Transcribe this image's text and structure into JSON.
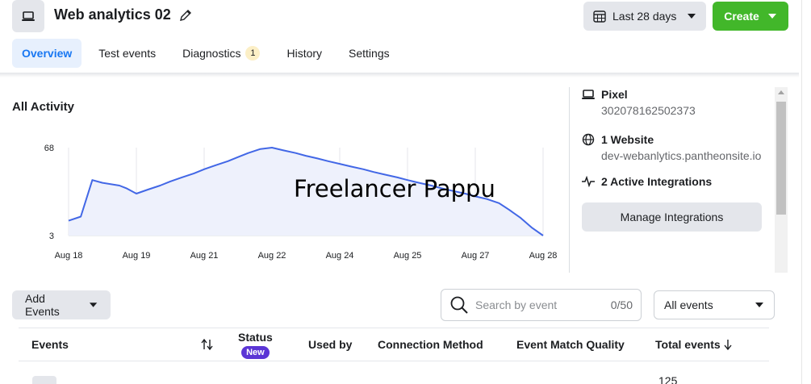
{
  "header": {
    "title": "Web analytics 02",
    "date_range": "Last 28 days",
    "create_label": "Create"
  },
  "tabs": [
    {
      "label": "Overview",
      "active": true
    },
    {
      "label": "Test events"
    },
    {
      "label": "Diagnostics",
      "badge": "1"
    },
    {
      "label": "History"
    },
    {
      "label": "Settings"
    }
  ],
  "activity": {
    "title": "All Activity",
    "watermark": "Freelancer Pappu"
  },
  "chart_data": {
    "type": "area",
    "categories": [
      "Aug 18",
      "Aug 19",
      "Aug 21",
      "Aug 22",
      "Aug 24",
      "Aug 25",
      "Aug 27",
      "Aug 28"
    ],
    "y_ticks": [
      "68",
      "3"
    ],
    "ylim": [
      3,
      68
    ],
    "x_positions": [
      0,
      0.18,
      0.35,
      0.5,
      0.75,
      0.85,
      1.0,
      1.17,
      1.35,
      1.5,
      1.67,
      1.85,
      2.0,
      2.17,
      2.35,
      2.5,
      2.65,
      2.83,
      3.0,
      3.17,
      3.35,
      3.5,
      3.67,
      3.83,
      4.0,
      4.17,
      4.35,
      4.5,
      4.67,
      4.85,
      5.0,
      5.17,
      5.35,
      5.5,
      5.67,
      5.85,
      6.0,
      6.17,
      6.35,
      6.5,
      6.67,
      6.83,
      7.0
    ],
    "values": [
      14,
      17,
      44,
      42,
      40,
      38,
      34,
      37,
      40,
      43,
      46,
      49,
      52,
      55,
      58,
      61,
      64,
      67,
      68,
      66,
      64,
      62,
      60,
      58,
      56,
      54,
      52,
      50,
      48,
      46,
      44,
      42,
      40,
      38,
      36,
      34,
      32,
      30,
      27,
      22,
      16,
      9,
      3
    ],
    "color": "#4267e6",
    "fill": "#eef1fc",
    "grid": "vertical"
  },
  "side_panel": {
    "pixel_label": "Pixel",
    "pixel_id": "302078162502373",
    "website_label": "1 Website",
    "website_url": "dev-webanlytics.pantheonsite.io",
    "integrations_label": "2 Active Integrations",
    "manage_label": "Manage Integrations"
  },
  "toolbar": {
    "add_events_label": "Add Events",
    "search_placeholder": "Search by event",
    "search_count": "0/50",
    "filter_value": "All events"
  },
  "table": {
    "columns": {
      "events": "Events",
      "status": "Status",
      "status_badge": "New",
      "used_by": "Used by",
      "connection": "Connection Method",
      "match_quality": "Event Match Quality",
      "total": "Total events"
    },
    "first_row_total": "125"
  },
  "colors": {
    "accent": "#1877f2",
    "create": "#42b72a",
    "new_badge": "#5b35d5"
  }
}
